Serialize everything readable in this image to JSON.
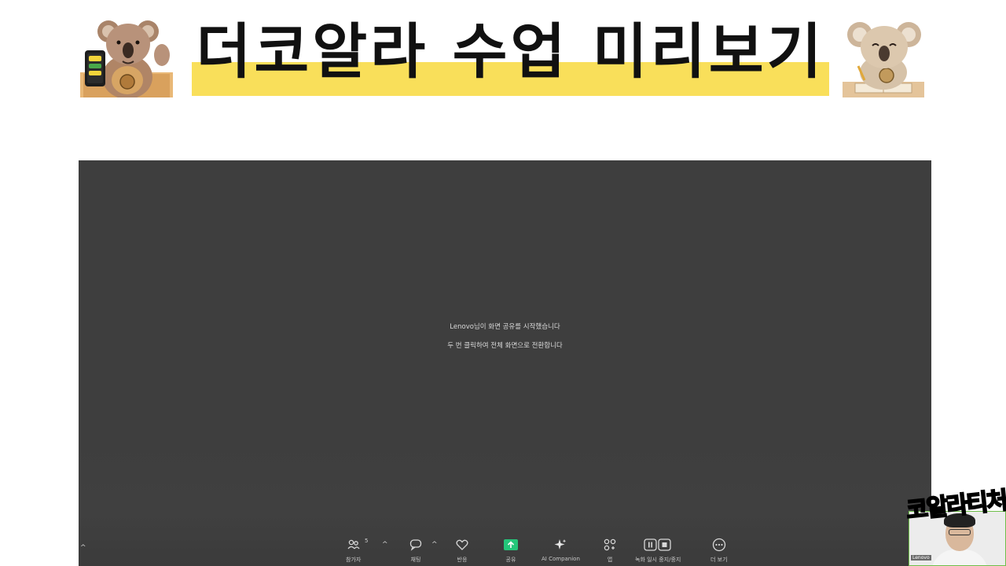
{
  "banner": {
    "title": "더코알라 수업 미리보기",
    "highlight_color": "#f9df5a"
  },
  "meeting": {
    "share_message": "Lenovo님이 화면 공유를 시작했습니다",
    "fullscreen_hint": "두 번 클릭하여 전체 화면으로 전환합니다"
  },
  "toolbar": {
    "participants": {
      "label": "참가자",
      "count": "5",
      "icon": "participants-icon"
    },
    "chat": {
      "label": "채팅",
      "icon": "chat-icon"
    },
    "reactions": {
      "label": "반응",
      "icon": "heart-icon"
    },
    "share": {
      "label": "공유",
      "icon": "share-arrow-icon",
      "accent": "#24c67a"
    },
    "ai_companion": {
      "label": "AI Companion",
      "icon": "sparkle-icon"
    },
    "apps": {
      "label": "앱",
      "icon": "apps-icon"
    },
    "recording": {
      "label": "녹화 일시 중지/중지",
      "icon": "pause-stop-icon"
    },
    "more": {
      "label": "더 보기",
      "icon": "more-icon"
    }
  },
  "webcam": {
    "name": "Lenovo",
    "caption": "코알라티처"
  }
}
